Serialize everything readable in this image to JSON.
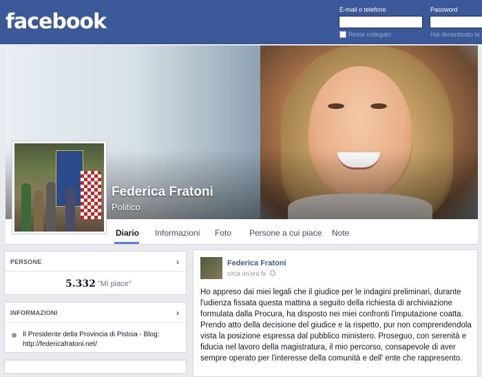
{
  "header": {
    "logo": "facebook",
    "email_label": "E-mail o telefono",
    "password_label": "Password",
    "remember_label": "Resta collegato",
    "forgot_label": "Hai dimenticato la p"
  },
  "profile": {
    "name": "Federica Fratoni",
    "category": "Politico"
  },
  "tabs": [
    "Diario",
    "Informazioni",
    "Foto",
    "Persone a cui piace",
    "Note"
  ],
  "people": {
    "title": "PERSONE",
    "likes_count": "5.332",
    "likes_label": "\"Mi piace\""
  },
  "info": {
    "title": "INFORMAZIONI",
    "text": "Il Presidente della Provincia di Pistoia - Blog: http://federicafratoni.net/"
  },
  "post": {
    "author": "Federica Fratoni",
    "time": "circa un'ora fa",
    "body": "Ho appreso dai miei legali che il giudice per le indagini preliminari, durante l'udienza fissata questa mattina a seguito della richiesta di archiviazione formulata dalla Procura, ha disposto nei miei confronti l'imputazione coatta. Prendo atto della decisione del giudice e la rispetto, pur non comprendendola vista la posizione espressa dal pubblico ministero. Proseguo, con serenità e fiducia nel lavoro della magistratura, il mio percorso, consapevole di aver sempre operato per l'interesse della comunità e dell' ente che rappresento."
  },
  "colors": {
    "brand": "#3b5998",
    "page_bg": "#e9eaed",
    "link": "#3b5998"
  }
}
